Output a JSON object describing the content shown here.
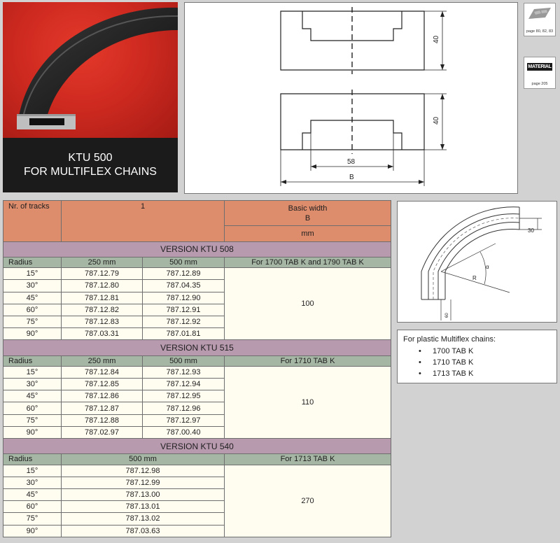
{
  "photo": {
    "title_line1": "KTU 500",
    "title_line2": "FOR MULTIFLEX CHAINS"
  },
  "drawing": {
    "dim_height_top": "40",
    "dim_height_bottom": "40",
    "dim_inner": "58",
    "dim_width": "B"
  },
  "refs": {
    "ref1_label": "page 80, 82, 83",
    "ref2_badge": "MATERIAL",
    "ref2_label": "page 205"
  },
  "bend_drawing": {
    "dim_30": "30",
    "dim_r": "R",
    "dim_small": "60",
    "angle_symbol": "α"
  },
  "info": {
    "title": "For plastic Multiflex chains:",
    "items": [
      "1700 TAB K",
      "1710 TAB K",
      "1713 TAB K"
    ]
  },
  "table": {
    "header": {
      "tracks_label": "Nr. of tracks",
      "tracks_value": "1",
      "basic_width_label": "Basic width",
      "basic_width_symbol": "B",
      "unit": "mm"
    },
    "versions": [
      {
        "title": "VERSION KTU 508",
        "columns": [
          "Radius",
          "250 mm",
          "500 mm",
          "For 1700 TAB K and 1790  TAB K"
        ],
        "width": "100",
        "rows": [
          [
            "15°",
            "787.12.79",
            "787.12.89"
          ],
          [
            "30°",
            "787.12.80",
            "787.04.35"
          ],
          [
            "45°",
            "787.12.81",
            "787.12.90"
          ],
          [
            "60°",
            "787.12.82",
            "787.12.91"
          ],
          [
            "75°",
            "787.12.83",
            "787.12.92"
          ],
          [
            "90°",
            "787.03.31",
            "787.01.81"
          ]
        ]
      },
      {
        "title": "VERSION KTU 515",
        "columns": [
          "Radius",
          "250 mm",
          "500 mm",
          "For 1710 TAB K"
        ],
        "width": "110",
        "rows": [
          [
            "15°",
            "787.12.84",
            "787.12.93"
          ],
          [
            "30°",
            "787.12.85",
            "787.12.94"
          ],
          [
            "45°",
            "787.12.86",
            "787.12.95"
          ],
          [
            "60°",
            "787.12.87",
            "787.12.96"
          ],
          [
            "75°",
            "787.12.88",
            "787.12.97"
          ],
          [
            "90°",
            "787.02.97",
            "787.00.40"
          ]
        ]
      },
      {
        "title": "VERSION KTU 540",
        "columns": [
          "Radius",
          "500 mm",
          "For 1713 TAB K"
        ],
        "width": "270",
        "rows": [
          [
            "15°",
            "787.12.98"
          ],
          [
            "30°",
            "787.12.99"
          ],
          [
            "45°",
            "787.13.00"
          ],
          [
            "60°",
            "787.13.01"
          ],
          [
            "75°",
            "787.13.02"
          ],
          [
            "90°",
            "787.03.63"
          ]
        ]
      }
    ]
  }
}
